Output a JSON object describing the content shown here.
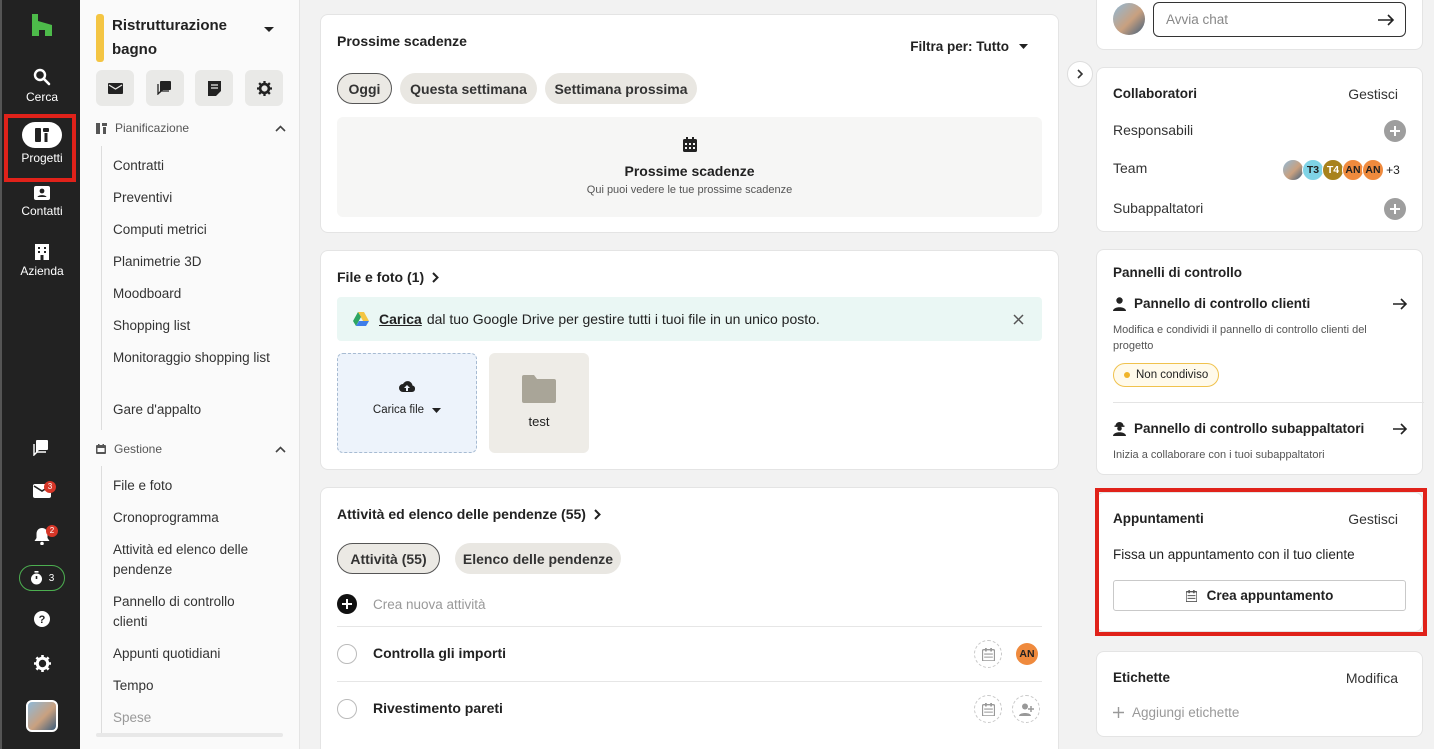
{
  "rail": {
    "items": [
      {
        "label": "Cerca",
        "icon": "search-icon"
      },
      {
        "label": "Progetti",
        "icon": "projects-icon"
      },
      {
        "label": "Contatti",
        "icon": "contacts-icon"
      },
      {
        "label": "Azienda",
        "icon": "building-icon"
      }
    ],
    "inbox_badge": "3",
    "notifications_badge": "2",
    "timer_count": "3"
  },
  "project": {
    "name": "Ristrutturazione bagno"
  },
  "leftnav": {
    "planning": {
      "label": "Pianificazione",
      "items": [
        "Contratti",
        "Preventivi",
        "Computi metrici",
        "Planimetrie 3D",
        "Moodboard",
        "Shopping list",
        "Monitoraggio shopping list",
        "Gare d'appalto"
      ]
    },
    "management": {
      "label": "Gestione",
      "items": [
        "File e foto",
        "Cronoprogramma",
        "Attività ed elenco delle pendenze",
        "Pannello di controllo clienti",
        "Appunti quotidiani",
        "Tempo",
        "Spese"
      ]
    }
  },
  "deadlines": {
    "title": "Prossime scadenze",
    "filter_label": "Filtra per: Tutto",
    "chips": [
      "Oggi",
      "Questa settimana",
      "Settimana prossima"
    ],
    "empty_title": "Prossime scadenze",
    "empty_subtitle": "Qui puoi vedere le tue prossime scadenze"
  },
  "files": {
    "title": "File e foto (1)",
    "banner_link": "Carica",
    "banner_text": "dal tuo Google Drive per gestire tutti i tuoi file in un unico posto.",
    "upload_label": "Carica file",
    "folder_name": "test"
  },
  "tasks": {
    "title": "Attività ed elenco delle pendenze (55)",
    "tabs": [
      "Attività (55)",
      "Elenco delle pendenze"
    ],
    "new_task_placeholder": "Crea nuova attività",
    "rows": [
      {
        "title": "Controlla gli importi",
        "assignee": "AN"
      },
      {
        "title": "Rivestimento pareti",
        "assignee": ""
      }
    ]
  },
  "chat": {
    "placeholder": "Avvia chat"
  },
  "collaborators": {
    "title": "Collaboratori",
    "manage": "Gestisci",
    "rows": [
      "Responsabili",
      "Team",
      "Subappaltatori"
    ],
    "team_avatars": [
      "T3",
      "T4",
      "AN",
      "AN"
    ],
    "team_more": "+3"
  },
  "dashboards": {
    "title": "Pannelli di controllo",
    "client": {
      "title": "Pannello di controllo clienti",
      "desc": "Modifica e condividi il pannello di controllo clienti del progetto",
      "status": "Non condiviso"
    },
    "sub": {
      "title": "Pannello di controllo subappaltatori",
      "desc": "Inizia a collaborare con i tuoi subappaltatori"
    }
  },
  "appointments": {
    "title": "Appuntamenti",
    "manage": "Gestisci",
    "desc": "Fissa un appuntamento con il tuo cliente",
    "button": "Crea appuntamento"
  },
  "labels": {
    "title": "Etichette",
    "edit": "Modifica",
    "add": "Aggiungi etichette"
  },
  "colors": {
    "rail_bg": "#222222",
    "highlight": "#e0221a",
    "brand_green": "#4caf50",
    "project_accent": "#f4c543",
    "badge_red": "#d63628"
  }
}
